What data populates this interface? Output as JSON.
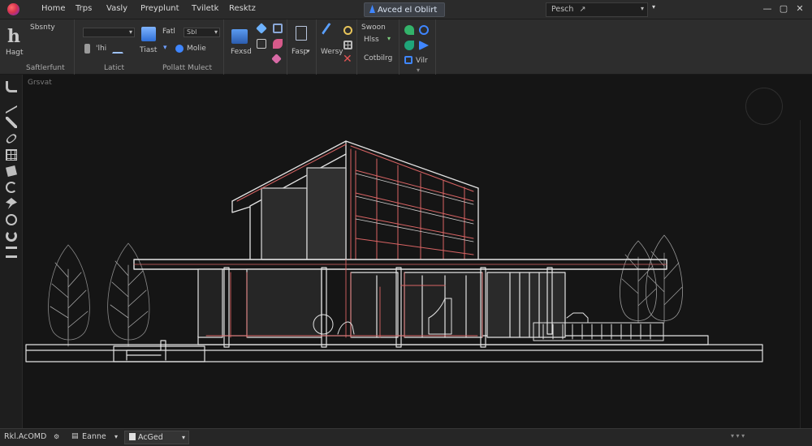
{
  "titlebar": {
    "menu": [
      "Home",
      "Trps",
      "Vasly",
      "Preyplunt",
      "Tviletk",
      "Resktz"
    ],
    "document_tab": "Avced el Oblirt",
    "search": "Pesch",
    "search_arrow": "↗",
    "controls": {
      "minimize": "—",
      "maximize": "▢",
      "close": "✕"
    }
  },
  "ribbon": {
    "panel1": {
      "big_label": "h",
      "sub_label": "Hagt",
      "top_label": "Sbsnty",
      "title": "Saftlerfunt"
    },
    "panel2": {
      "dropdown1": "",
      "dropdown2": "Sbl",
      "fld_label": "Fatl",
      "lbl_a": "'lhi",
      "lbl_b": "Tiast",
      "lbl_c": "Molie",
      "title_left": "Latict",
      "title_right": "Pollatt Mulect"
    },
    "panel3": {
      "label": "Fexsd"
    },
    "panel4": {
      "label": "Fasp"
    },
    "panel5": {
      "label": "Wersy"
    },
    "panel6": {
      "label_top": "Swoon",
      "label_mid": "Hlss",
      "label_bottom": "Cotbilrg"
    },
    "panel7": {
      "label": "Vilr"
    }
  },
  "canvas": {
    "label": "Grsvat"
  },
  "icons": {
    "app_logo": "app-logo-icon",
    "left_tools": [
      "select-icon",
      "polyline-icon",
      "pencil-icon",
      "eraser-icon",
      "grid-icon",
      "layer-icon",
      "rotate-icon",
      "pin-icon",
      "clock-icon",
      "refresh-icon",
      "scale-icon"
    ]
  },
  "statusbar": {
    "app_name": "Rkl.AcOMD",
    "page_label": "Eanne",
    "active_tab": "AcGed",
    "chevrons": "▾"
  },
  "colors": {
    "accent": "#3f86ff",
    "redline": "#d96464",
    "whiteline": "#e3e3e3"
  }
}
